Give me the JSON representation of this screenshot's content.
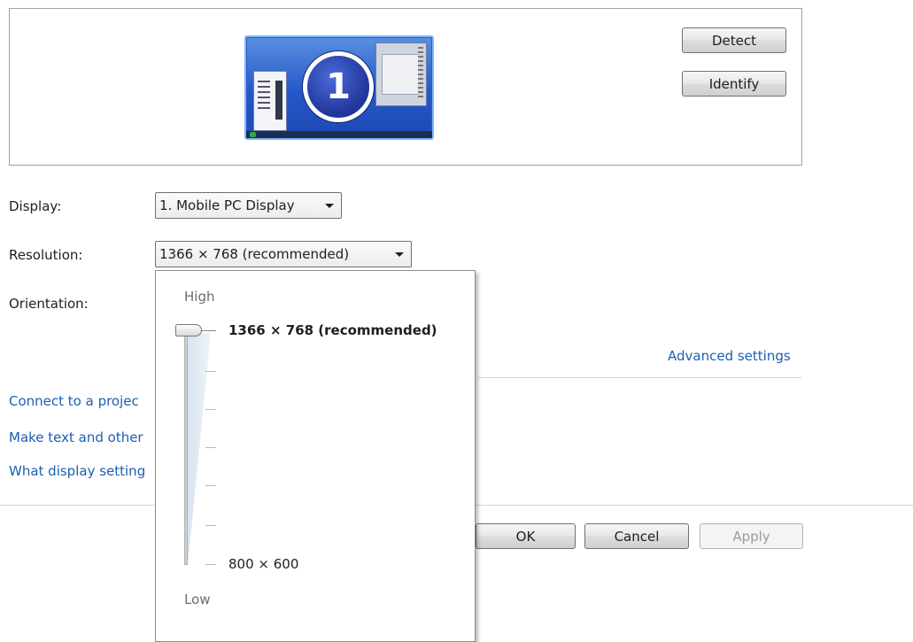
{
  "preview": {
    "monitor_number": "1",
    "detect_label": "Detect",
    "identify_label": "Identify"
  },
  "settings": {
    "display_label": "Display:",
    "display_value": "1. Mobile PC Display",
    "resolution_label": "Resolution:",
    "resolution_value": "1366 × 768 (recommended)",
    "orientation_label": "Orientation:"
  },
  "links": {
    "advanced_settings": "Advanced settings",
    "connect_projector": "Connect to a projec",
    "make_text": "Make text and other",
    "what_display": "What display setting"
  },
  "resolution_popup": {
    "high_label": "High",
    "low_label": "Low",
    "max_resolution": "1366 × 768 (recommended)",
    "min_resolution": "800 × 600",
    "slider_level": 1.0
  },
  "footer": {
    "ok_label": "OK",
    "cancel_label": "Cancel",
    "apply_label": "Apply"
  }
}
